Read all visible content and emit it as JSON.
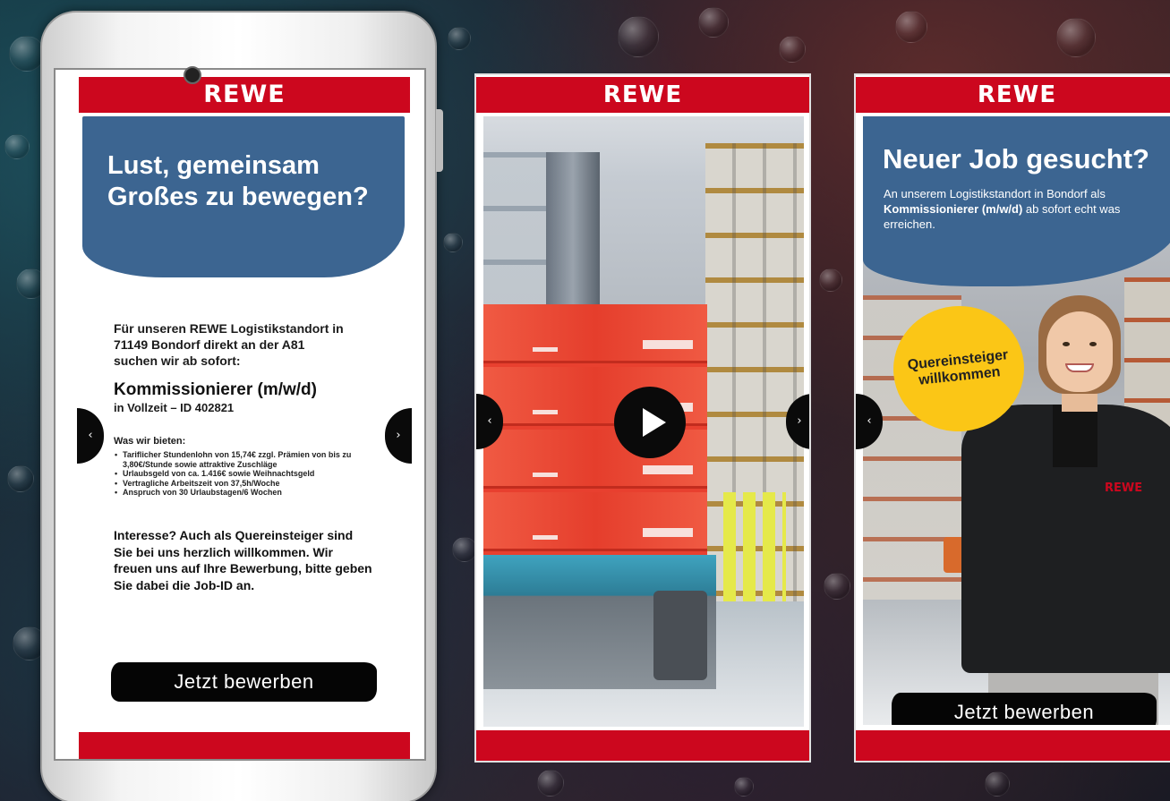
{
  "brand": "REWE",
  "colors": {
    "rewe_red": "#cc071e",
    "blue": "#3c6591",
    "yellow_badge": "#fbc616",
    "cta_black": "#050505"
  },
  "panel1": {
    "headline_line1": "Lust, gemeinsam",
    "headline_line2": "Großes zu bewegen?",
    "intro_line1": "Für unseren REWE Logistikstandort in",
    "intro_line2": "71149 Bondorf direkt an der A81",
    "intro_line3": "suchen wir ab sofort:",
    "job_title": "Kommissionierer (m/w/d)",
    "job_sub": "in Vollzeit – ID 402821",
    "offer_title": "Was wir bieten:",
    "offers": [
      "Tariflicher Stundenlohn von 15,74€ zzgl. Prämien von bis zu 3,80€/Stunde sowie attraktive Zuschläge",
      "Urlaubsgeld von ca. 1.416€ sowie Weihnachtsgeld",
      "Vertragliche Arbeitszeit von 37,5h/Woche",
      "Anspruch von 30 Urlaubstagen/6 Wochen"
    ],
    "interest": "Interesse? Auch als Quereinsteiger sind Sie bei uns herzlich willkommen. Wir freuen uns auf Ihre Bewerbung, bitte geben Sie dabei die Job-ID an.",
    "cta": "Jetzt bewerben"
  },
  "panel3": {
    "headline": "Neuer Job gesucht?",
    "text_part1": "An unserem Logistikstandort in Bondorf als ",
    "text_bold": "Kommissionierer (m/w/d)",
    "text_part2": " ab sofort echt was erreichen.",
    "badge_line1": "Quereinsteiger",
    "badge_line2": "willkommen",
    "jacket_logo": "REWE",
    "cta": "Jetzt bewerben"
  },
  "icons": {
    "prev": "‹",
    "next": "›",
    "play": "play-icon"
  }
}
